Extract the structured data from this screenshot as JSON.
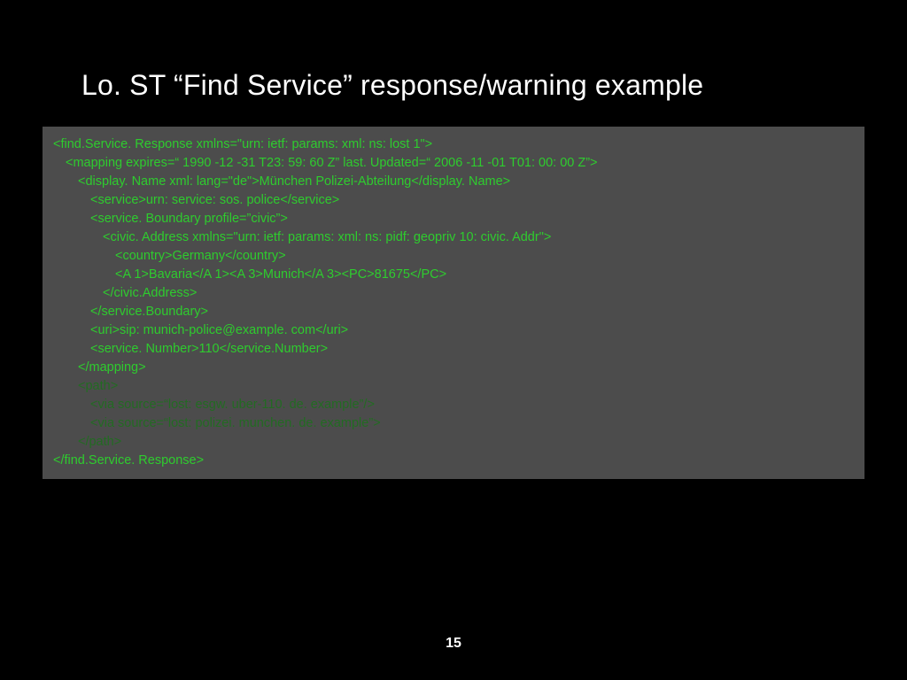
{
  "title": "Lo. ST “Find Service” response/warning example",
  "page_number": "15",
  "code": {
    "l01": "<find.Service. Response xmlns=\"urn: ietf: params: xml: ns: lost 1\">",
    "l02": "<mapping expires=“ 1990 -12 -31 T23: 59: 60 Z” last. Updated=“ 2006 -11 -01 T01: 00: 00 Z”>",
    "l03": "<display. Name xml: lang=\"de\">München Polizei-Abteilung</display. Name>",
    "l04": "<service>urn: service: sos. police</service>",
    "l05": "<service. Boundary profile=”civic”>",
    "l06": "<civic. Address xmlns=\"urn: ietf: params: xml: ns: pidf: geopriv 10: civic. Addr\">",
    "l07": "<country>Germany</country>",
    "l08": "<A 1>Bavaria</A 1><A 3>Munich</A 3><PC>81675</PC>",
    "l09": "</civic.Address>",
    "l10": "</service.Boundary>",
    "l11": "<uri>sip: munich-police@example. com</uri>",
    "l12": "<service. Number>110</service.Number>",
    "l13": "</mapping>",
    "l14": "<path>",
    "l15": "<via source=“lost: esgw. uber-110. de. example”/>",
    "l16": "<via source=“lost: polizei. munchen. de. example”>",
    "l17": "</path>",
    "l18": "</find.Service. Response>"
  }
}
